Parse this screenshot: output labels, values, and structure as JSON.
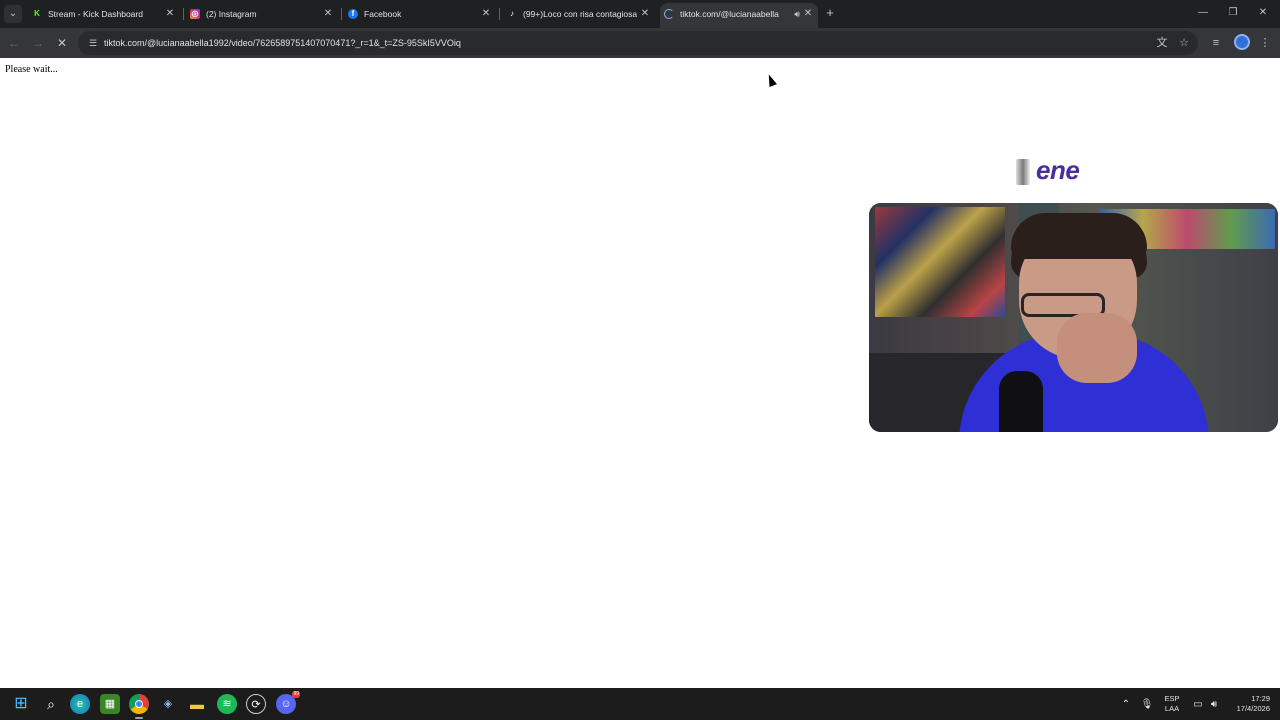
{
  "browser": {
    "tabs": [
      {
        "title": "Stream - Kick Dashboard",
        "icon": "kick-icon"
      },
      {
        "title": "(2) Instagram",
        "icon": "instagram-icon"
      },
      {
        "title": "Facebook",
        "icon": "facebook-icon"
      },
      {
        "title": "(99+)Loco con risa contagiosa",
        "icon": "tiktok-icon"
      },
      {
        "title": "tiktok.com/@lucianaabella",
        "icon": "loading-spinner-icon",
        "active": true
      }
    ],
    "new_tab_label": "+",
    "address": "tiktok.com/@lucianaabella1992/video/7626589751407070471?_r=1&_t=ZS-95SkI5VVOiq"
  },
  "page": {
    "status_text": "Please wait..."
  },
  "stream_overlay": {
    "logo_text": "ene"
  },
  "taskbar": {
    "apps": [
      "windows-start-icon",
      "search-icon",
      "edge-icon",
      "minecraft-icon",
      "chrome-icon",
      "app-icon",
      "file-explorer-icon",
      "spotify-icon",
      "app-icon-2",
      "discord-icon"
    ],
    "language_top": "ESP",
    "language_bottom": "LAA",
    "time": "17:29",
    "date": "17/4/2026",
    "discord_badge": "99"
  },
  "colors": {
    "chrome_bg": "#1f2022",
    "toolbar_bg": "#35363a",
    "taskbar_bg": "#1c1c1c",
    "overlay_logo": "#4a2e9b"
  }
}
